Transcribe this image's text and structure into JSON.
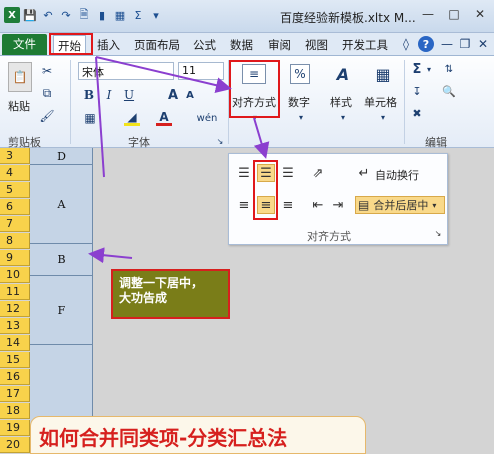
{
  "window": {
    "title": "百度经验新模板.xltx M...",
    "app_icon": "X"
  },
  "tabs": [
    {
      "label": "文件"
    },
    {
      "label": "开始"
    },
    {
      "label": "插入"
    },
    {
      "label": "页面布局"
    },
    {
      "label": "公式"
    },
    {
      "label": "数据"
    },
    {
      "label": "审阅"
    },
    {
      "label": "视图"
    },
    {
      "label": "开发工具"
    }
  ],
  "ribbon": {
    "paste_label": "粘贴",
    "clipboard_group": "剪贴板",
    "font_name": "宋体",
    "font_size": "11",
    "font_group": "字体",
    "bold": "B",
    "italic": "I",
    "underline": "U",
    "grow_font": "A",
    "shrink_font": "A",
    "font_color": "A",
    "phonetic": "wén",
    "alignment_label": "对齐方式",
    "number_label": "数字",
    "number_symbol": "%",
    "styles_label": "样式",
    "cells_label": "单元格",
    "editing_group": "编辑",
    "sum_symbol": "Σ"
  },
  "alignment_panel": {
    "wrap_text": "自动换行",
    "merge_center": "合并后居中",
    "group_label": "对齐方式"
  },
  "sheet": {
    "rows": [
      "3",
      "4",
      "5",
      "6",
      "7",
      "8",
      "9",
      "10",
      "11",
      "12",
      "13",
      "14",
      "15",
      "16",
      "17",
      "18",
      "19",
      "20"
    ],
    "cells": [
      {
        "value": "D"
      },
      {
        "value": "A"
      },
      {
        "value": "B"
      },
      {
        "value": "F"
      }
    ]
  },
  "callout": {
    "line1": "调整一下居中，",
    "line2": "大功告成"
  },
  "banner": {
    "text": "如何合并同类项-分类汇总法"
  },
  "colors": {
    "file_tab": "#1e7b34",
    "highlight_border": "#e0181b",
    "arrow": "#8b3fcf",
    "row_header": "#f8d24b",
    "selected_column": "#c5d4e6",
    "callout_bg": "#7a7d18",
    "banner_text": "#d6201e"
  }
}
